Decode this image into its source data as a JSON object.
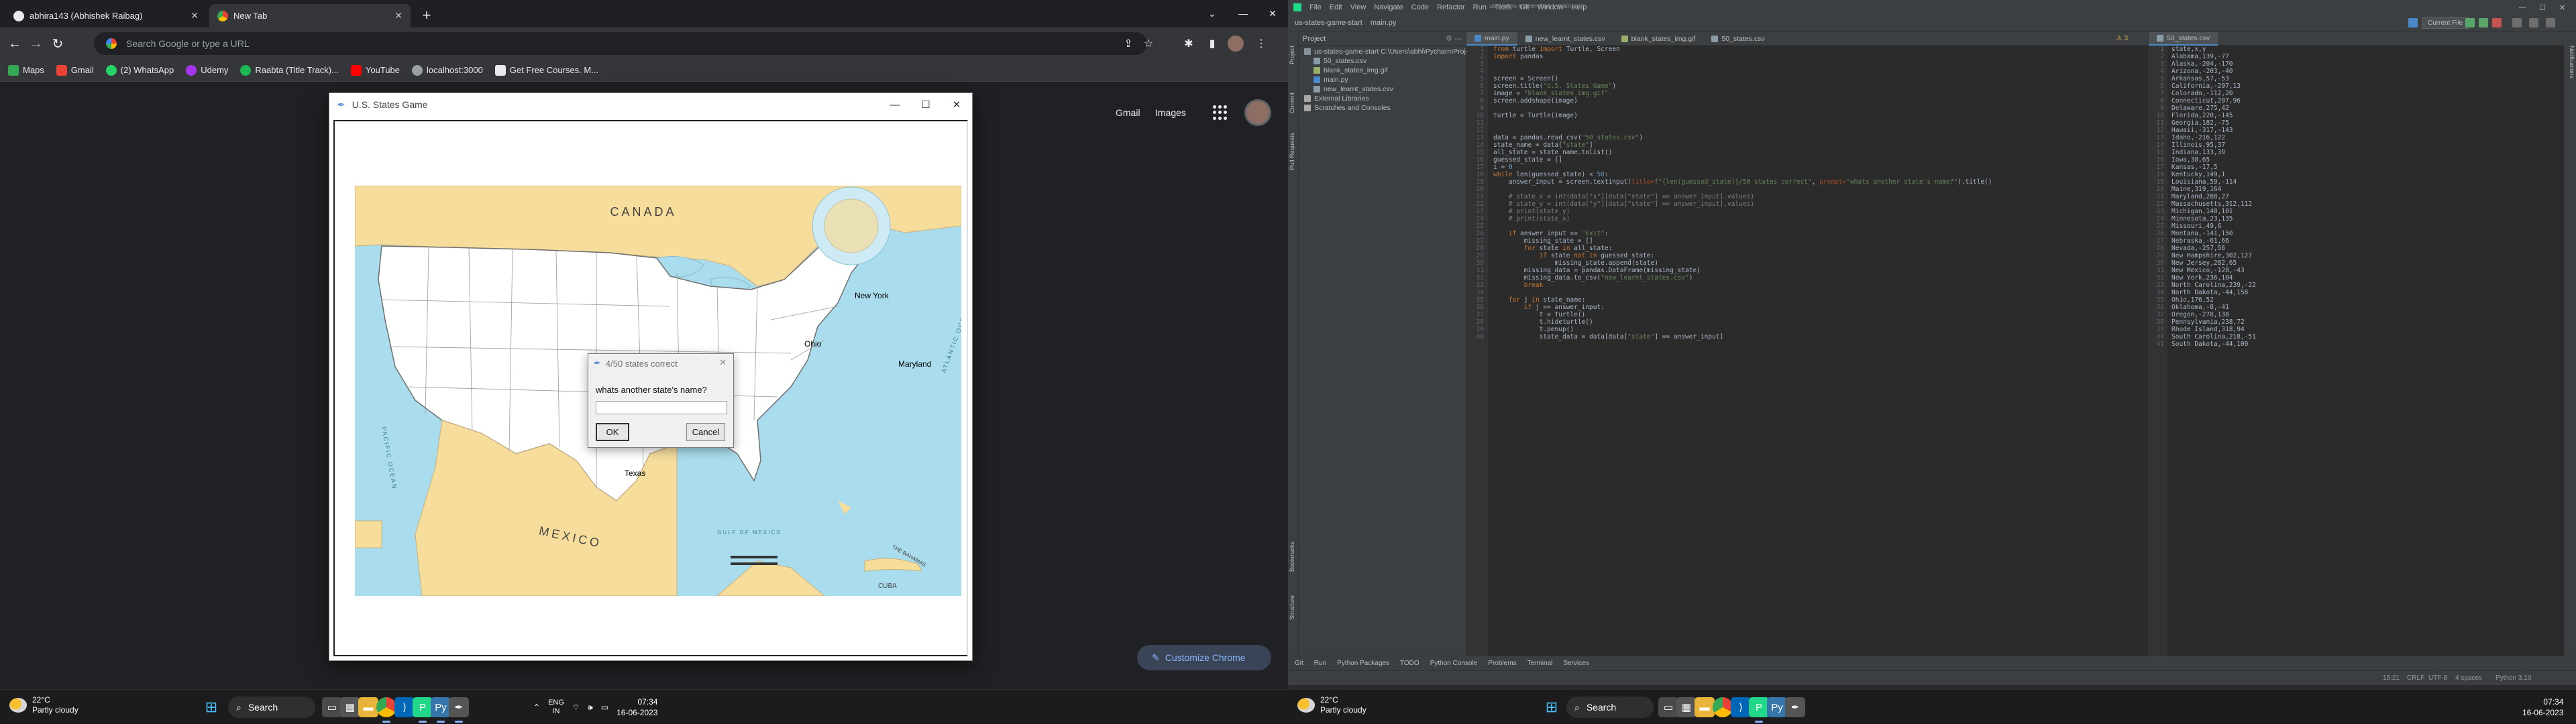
{
  "chrome": {
    "tabs": [
      {
        "label": "abhira143 (Abhishek Raibag)",
        "active": false
      },
      {
        "label": "New Tab",
        "active": true
      }
    ],
    "omnibox_placeholder": "Search Google or type a URL",
    "bookmarks": [
      {
        "label": "Maps",
        "icon": "maps-icon",
        "color": "#34a853"
      },
      {
        "label": "Gmail",
        "icon": "gmail-icon",
        "color": "#ea4335"
      },
      {
        "label": "(2) WhatsApp",
        "icon": "whatsapp-icon",
        "color": "#25d366"
      },
      {
        "label": "Udemy",
        "icon": "udemy-icon",
        "color": "#a435f0"
      },
      {
        "label": "Raabta (Title Track)...",
        "icon": "spotify-icon",
        "color": "#1db954"
      },
      {
        "label": "YouTube",
        "icon": "youtube-icon",
        "color": "#ff0000"
      },
      {
        "label": "localhost:3000",
        "icon": "globe-icon",
        "color": "#9aa0a6"
      },
      {
        "label": "Get Free Courses. M...",
        "icon": "document-icon",
        "color": "#e8eaed"
      }
    ],
    "ntp": {
      "gmail": "Gmail",
      "images": "Images",
      "customize": "Customize Chrome"
    }
  },
  "turtle_window": {
    "title": "U.S. States Game",
    "map_labels": {
      "canada": "CANADA",
      "mexico": "MEXICO",
      "pacific": "PACIFIC OCEAN",
      "atlantic": "ATLANTIC OCEAN",
      "gulf": "GULF OF MEXICO",
      "bahamas": "THE BAHAMAS",
      "cuba": "CUBA",
      "texas": "Texas",
      "ohio": "Ohio",
      "newyork": "New York",
      "maryland": "Maryland"
    }
  },
  "dialog": {
    "title": "4/50 states correct",
    "prompt": "whats another state's name?",
    "input_value": "",
    "ok": "OK",
    "cancel": "Cancel"
  },
  "taskbar_left": {
    "temp": "22°C",
    "condition": "Partly cloudy",
    "search": "Search",
    "lang1": "ENG",
    "lang2": "IN",
    "time": "07:34",
    "date": "16-06-2023"
  },
  "pycharm": {
    "menus": [
      "File",
      "Edit",
      "View",
      "Navigate",
      "Code",
      "Refactor",
      "Run",
      "Tools",
      "Git",
      "Window",
      "Help"
    ],
    "title_text": "us-states-game-start - main.py",
    "crumbs": [
      "us-states-game-start",
      "main.py"
    ],
    "run_config": "Current File",
    "project_header": "Project",
    "tree": [
      {
        "label": "us-states-game-start  C:\\Users\\abhi\\PycharmProjects\\us-states-game-start",
        "indent": 0,
        "icon": "folder-icon",
        "color": "#87939a"
      },
      {
        "label": "50_states.csv",
        "indent": 1,
        "icon": "csv-file-icon",
        "color": "#8a9da6"
      },
      {
        "label": "blank_states_img.gif",
        "indent": 1,
        "icon": "image-file-icon",
        "color": "#9aae6c"
      },
      {
        "label": "main.py",
        "indent": 1,
        "icon": "python-file-icon",
        "color": "#4a88c7"
      },
      {
        "label": "new_learnt_states.csv",
        "indent": 1,
        "icon": "csv-file-icon",
        "color": "#8a9da6"
      },
      {
        "label": "External Libraries",
        "indent": 0,
        "icon": "library-icon",
        "color": "#a9a9a9"
      },
      {
        "label": "Scratches and Consoles",
        "indent": 0,
        "icon": "console-icon",
        "color": "#a9a9a9"
      }
    ],
    "editor_tabs": [
      "main.py",
      "new_learnt_states.csv",
      "blank_states_img.gif",
      "50_states.csv"
    ],
    "csv_tab": "50_states.csv",
    "code_lines": [
      [
        [
          "k",
          "from "
        ],
        [
          "t",
          "turtle "
        ],
        [
          "k",
          "import "
        ],
        [
          "t",
          "Turtle, Screen"
        ]
      ],
      [
        [
          "k",
          "import "
        ],
        [
          "t",
          "pandas"
        ]
      ],
      [],
      [],
      [
        [
          "t",
          "screen = Screen()"
        ]
      ],
      [
        [
          "t",
          "screen.title("
        ],
        [
          "s",
          "\"U.S. States Game\""
        ],
        [
          "t",
          ")"
        ]
      ],
      [
        [
          "t",
          "image = "
        ],
        [
          "s",
          "\"blank_states_img.gif\""
        ]
      ],
      [
        [
          "t",
          "screen.addshape(image)"
        ]
      ],
      [],
      [
        [
          "t",
          "turtle = Turtle(image)"
        ]
      ],
      [],
      [],
      [
        [
          "t",
          "data = pandas.read_csv("
        ],
        [
          "s",
          "\"50_states.csv\""
        ],
        [
          "t",
          ")"
        ]
      ],
      [
        [
          "t",
          "state_name = data["
        ],
        [
          "s",
          "\"state\""
        ],
        [
          "t",
          "]"
        ]
      ],
      [
        [
          "t",
          "all_state = state_name.tolist()"
        ]
      ],
      [
        [
          "t",
          "guessed_state = []"
        ]
      ],
      [
        [
          "t",
          "i = "
        ],
        [
          "n",
          "0"
        ]
      ],
      [
        [
          "k",
          "while "
        ],
        [
          "t",
          "len(guessed_state) < "
        ],
        [
          "n",
          "50"
        ],
        [
          "t",
          ":"
        ]
      ],
      [
        [
          "t",
          "    answer_input = screen.textinput("
        ],
        [
          "p",
          "title="
        ],
        [
          "s",
          "f\"{len(guessed_state)}/50 states correct\""
        ],
        [
          "t",
          ", "
        ],
        [
          "p",
          "prompt="
        ],
        [
          "s",
          "\"whats another state's name?\""
        ],
        [
          "t",
          ").title()"
        ]
      ],
      [],
      [
        [
          "c",
          "    # state_x = int(data[\"x\"][data[\"state\"] == answer_input].values)"
        ]
      ],
      [
        [
          "c",
          "    # state_y = int(data[\"y\"][data[\"state\"] == answer_input].values)"
        ]
      ],
      [
        [
          "c",
          "    # print(state_y)"
        ]
      ],
      [
        [
          "c",
          "    # print(state_x)"
        ]
      ],
      [],
      [
        [
          "k",
          "    if "
        ],
        [
          "t",
          "answer_input == "
        ],
        [
          "s",
          "\"Exit\""
        ],
        [
          "t",
          ":"
        ]
      ],
      [
        [
          "t",
          "        missing_state = []"
        ]
      ],
      [
        [
          "k",
          "        for "
        ],
        [
          "t",
          "state "
        ],
        [
          "k",
          "in "
        ],
        [
          "t",
          "all_state:"
        ]
      ],
      [
        [
          "k",
          "            if "
        ],
        [
          "t",
          "state "
        ],
        [
          "k",
          "not in "
        ],
        [
          "t",
          "guessed_state:"
        ]
      ],
      [
        [
          "t",
          "                missing_state.append(state)"
        ]
      ],
      [
        [
          "t",
          "        missing_data = pandas.DataFrame(missing_state)"
        ]
      ],
      [
        [
          "t",
          "        missing_data.to_csv("
        ],
        [
          "s",
          "\"new_learnt_states.csv\""
        ],
        [
          "t",
          ")"
        ]
      ],
      [
        [
          "k",
          "        break"
        ]
      ],
      [],
      [
        [
          "k",
          "    for "
        ],
        [
          "t",
          "j "
        ],
        [
          "k",
          "in "
        ],
        [
          "t",
          "state_name:"
        ]
      ],
      [
        [
          "k",
          "        if "
        ],
        [
          "t",
          "j == answer_input:"
        ]
      ],
      [
        [
          "t",
          "            t = Turtle()"
        ]
      ],
      [
        [
          "t",
          "            t.hideturtle()"
        ]
      ],
      [
        [
          "t",
          "            t.penup()"
        ]
      ],
      [
        [
          "t",
          "            state_data = data[data["
        ],
        [
          "s",
          "\"state\""
        ],
        [
          "t",
          "] == answer_input]"
        ]
      ]
    ],
    "csv_lines": [
      "state,x,y",
      "Alabama,139,-77",
      "Alaska,-204,-170",
      "Arizona,-203,-40",
      "Arkansas,57,-53",
      "California,-297,13",
      "Colorado,-112,20",
      "Connecticut,297,96",
      "Delaware,275,42",
      "Florida,220,-145",
      "Georgia,182,-75",
      "Hawaii,-317,-143",
      "Idaho,-216,122",
      "Illinois,95,37",
      "Indiana,133,39",
      "Iowa,38,65",
      "Kansas,-17,5",
      "Kentucky,149,1",
      "Louisiana,59,-114",
      "Maine,319,164",
      "Maryland,288,27",
      "Massachusetts,312,112",
      "Michigan,148,101",
      "Minnesota,23,135",
      "Missouri,49,6",
      "Montana,-141,150",
      "Nebraska,-61,66",
      "Nevada,-257,56",
      "New Hampshire,302,127",
      "New Jersey,282,65",
      "New Mexico,-128,-43",
      "New York,236,104",
      "North Carolina,239,-22",
      "North Dakota,-44,158",
      "Ohio,176,52",
      "Oklahoma,-8,-41",
      "Oregon,-278,138",
      "Pennsylvania,238,72",
      "Rhode Island,318,94",
      "South Carolina,218,-51",
      "South Dakota,-44,109"
    ],
    "bottom_tools": [
      "Git",
      "Run",
      "Python Packages",
      "TODO",
      "Python Console",
      "Problems",
      "Terminal",
      "Services"
    ],
    "status": {
      "pos": "15:21",
      "eol": "CRLF",
      "enc": "UTF-8",
      "indent": "4 spaces",
      "interp": "Python 3.10"
    },
    "warnings": "3"
  },
  "taskbar_right": {
    "temp": "22°C",
    "condition": "Partly cloudy",
    "search": "Search",
    "time": "07:34",
    "date": "16-06-2023"
  }
}
